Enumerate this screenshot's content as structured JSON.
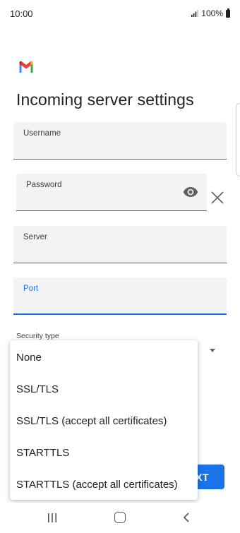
{
  "status_bar": {
    "time": "10:00",
    "battery": "100%"
  },
  "app": {
    "logo_icon": "gmail-logo-icon"
  },
  "page": {
    "title": "Incoming server settings"
  },
  "fields": {
    "username": {
      "label": "Username",
      "value": ""
    },
    "password": {
      "label": "Password",
      "value": ""
    },
    "server": {
      "label": "Server",
      "value": ""
    },
    "port": {
      "label": "Port",
      "value": ""
    }
  },
  "security": {
    "label": "Security type"
  },
  "dropdown": {
    "options": [
      "None",
      "SSL/TLS",
      "SSL/TLS (accept all certificates)",
      "STARTTLS",
      "STARTTLS (accept all certificates)"
    ]
  },
  "buttons": {
    "next": "XT"
  },
  "colors": {
    "accent": "#1a73e8",
    "field_bg": "#f1f3f4"
  }
}
